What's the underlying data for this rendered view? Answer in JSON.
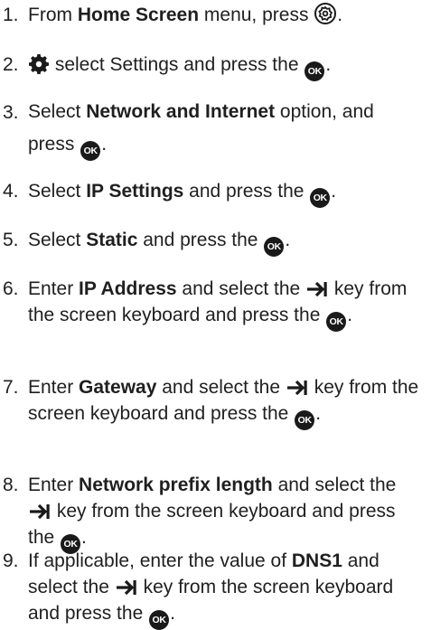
{
  "ok_label": "OK",
  "steps": [
    {
      "num": "1.",
      "a": "From ",
      "b1": "Home Screen",
      "c": " menu, press ",
      "end": "."
    },
    {
      "num": "2.",
      "a": " select Settings and press the ",
      "end": "."
    },
    {
      "num": "3.",
      "a": "Select ",
      "b1": "Network and Internet",
      "c": " option, and press ",
      "end": "."
    },
    {
      "num": "4.",
      "a": "Select ",
      "b1": "IP Settings",
      "c": " and press the ",
      "end": "."
    },
    {
      "num": "5.",
      "a": "Select ",
      "b1": "Static",
      "c": " and press the ",
      "end": "."
    },
    {
      "num": "6.",
      "a": "Enter ",
      "b1": "IP Address",
      "c": " and select the ",
      "d": " key from the screen keyboard and press the ",
      "end": "."
    },
    {
      "num": "7.",
      "a": "Enter ",
      "b1": "Gateway",
      "c": " and select the ",
      "d": " key from the screen keyboard and press the ",
      "end": "."
    },
    {
      "num": "8.",
      "a": "Enter ",
      "b1": "Network prefix length",
      "c": " and select the ",
      "d": " key from the screen keyboard and press the ",
      "end": "."
    },
    {
      "num": "9.",
      "a": "If applicable, enter the value of ",
      "b1": "DNS1",
      "c": " and select the ",
      "d": " key from the screen keyboard and press the ",
      "end": "."
    }
  ]
}
